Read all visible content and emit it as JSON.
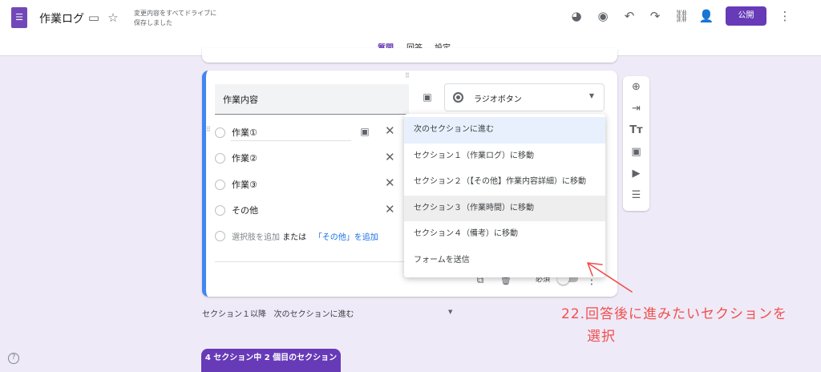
{
  "header": {
    "title": "作業ログ",
    "save_status_line1": "変更内容をすべてドライブに",
    "save_status_line2": "保存しました",
    "publish": "公開"
  },
  "tabs": [
    {
      "label": "質問",
      "active": true
    },
    {
      "label": "回答"
    },
    {
      "label": "設定"
    }
  ],
  "question": {
    "title": "作業内容",
    "type": "ラジオボタン",
    "options": [
      "作業①",
      "作業②",
      "作業③",
      "その他"
    ],
    "add_option": "選択肢を追加",
    "or": "または",
    "add_other": "「その他」を追加",
    "required": "必須"
  },
  "menu": {
    "items": [
      "次のセクションに進む",
      "セクション１（作業ログ）に移動",
      "セクション２（【その他】作業内容詳細）に移動",
      "セクション３（作業時間）に移動",
      "セクション４（備考）に移動",
      "フォームを送信"
    ]
  },
  "section_footer": {
    "label": "セクション１以降",
    "value": "次のセクションに進む"
  },
  "section_tab": "4 セクション中 2 個目のセクション",
  "annotation": {
    "line1": "22.回答後に進みたいセクションを",
    "line2": "選択"
  },
  "colors": {
    "accent": "#673ab7",
    "annotation": "#f0504f",
    "link": "#1a73e8"
  }
}
